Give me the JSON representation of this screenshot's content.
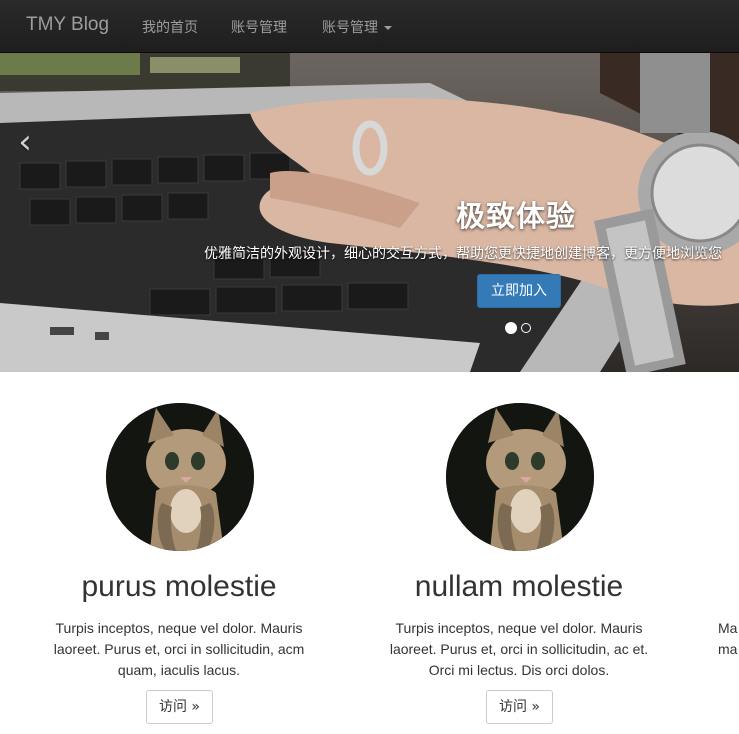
{
  "navbar": {
    "brand": "TMY Blog",
    "home": "我的首页",
    "account": "账号管理",
    "account_dropdown": "账号管理"
  },
  "carousel": {
    "title": "极致体验",
    "text": "优雅简洁的外观设计，细心的交互方式，帮助您更快捷地创建博客，更方便地浏览您",
    "button": "立即加入",
    "prev_icon": "chevron-left-icon",
    "active_slide": 1,
    "slide_count": 2
  },
  "features": [
    {
      "title": "purus molestie",
      "text": "Turpis inceptos, neque vel dolor. Mauris laoreet. Purus et, orci in sollicitudin, acm quam, iaculis lacus.",
      "button": "访问 »"
    },
    {
      "title": "nullam molestie",
      "text": "Turpis inceptos, neque vel dolor. Mauris laoreet. Purus et, orci in sollicitudin, ac et. Orci mi lectus. Dis orci dolos.",
      "button": "访问 »"
    },
    {
      "text_line1": "Ma",
      "text_line2": "ma"
    }
  ],
  "colors": {
    "navbar_bg": "#222222",
    "primary": "#337ab7"
  }
}
